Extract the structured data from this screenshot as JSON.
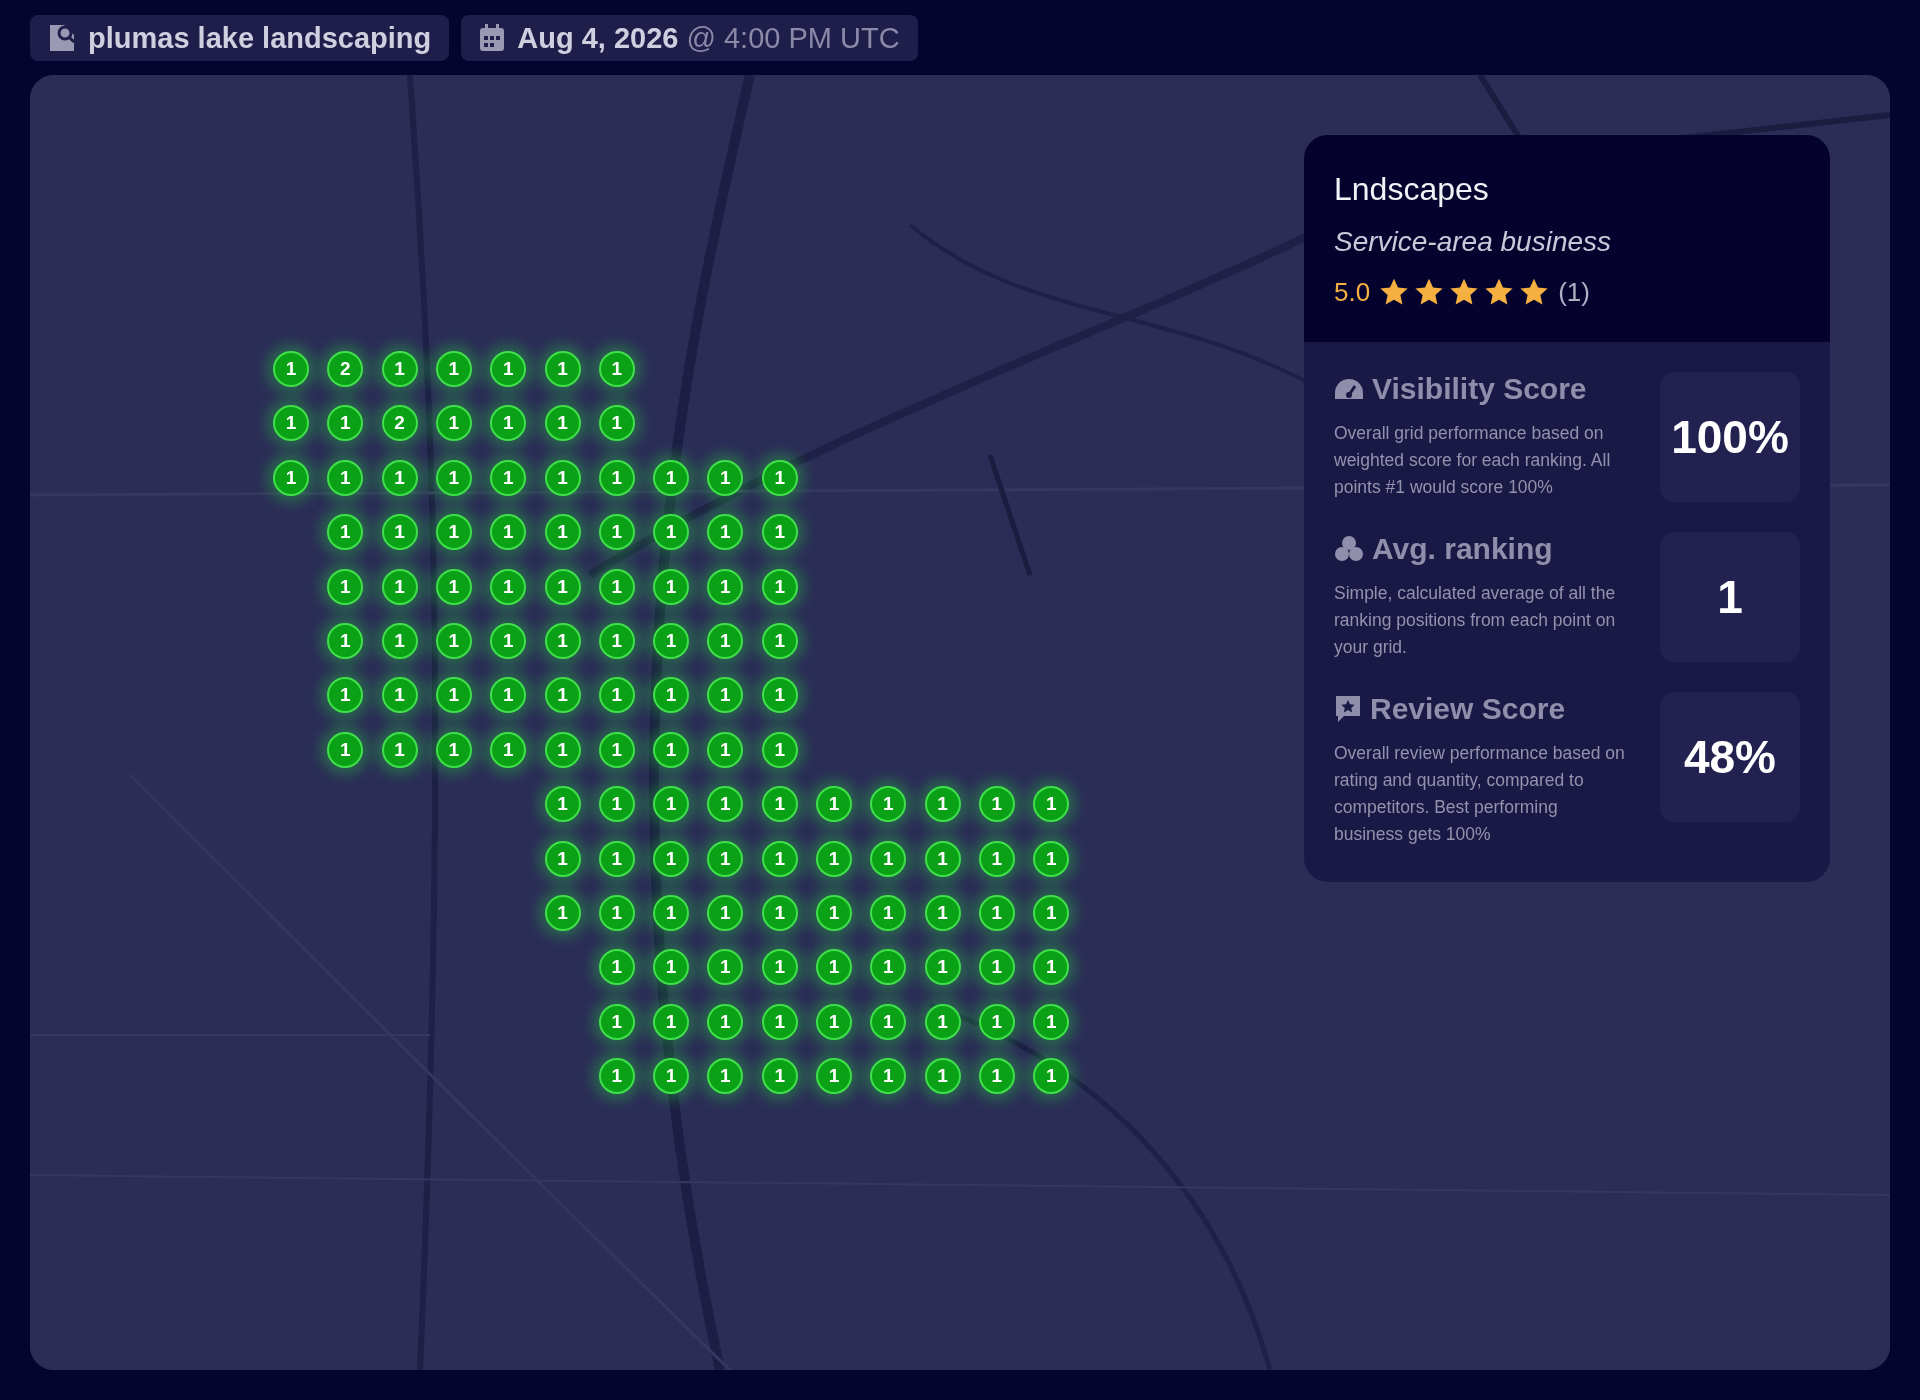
{
  "header": {
    "keyword": "plumas lake landscaping",
    "date": "Aug 4, 2026",
    "time": "@ 4:00 PM UTC"
  },
  "grid": {
    "rows": [
      [
        "1",
        "2",
        "1",
        "1",
        "1",
        "1",
        "1",
        null,
        null,
        null,
        null,
        null,
        null,
        null,
        null
      ],
      [
        "1",
        "1",
        "2",
        "1",
        "1",
        "1",
        "1",
        null,
        null,
        null,
        null,
        null,
        null,
        null,
        null
      ],
      [
        "1",
        "1",
        "1",
        "1",
        "1",
        "1",
        "1",
        "1",
        "1",
        "1",
        null,
        null,
        null,
        null,
        null
      ],
      [
        null,
        "1",
        "1",
        "1",
        "1",
        "1",
        "1",
        "1",
        "1",
        "1",
        null,
        null,
        null,
        null,
        null
      ],
      [
        null,
        "1",
        "1",
        "1",
        "1",
        "1",
        "1",
        "1",
        "1",
        "1",
        null,
        null,
        null,
        null,
        null
      ],
      [
        null,
        "1",
        "1",
        "1",
        "1",
        "1",
        "1",
        "1",
        "1",
        "1",
        null,
        null,
        null,
        null,
        null
      ],
      [
        null,
        "1",
        "1",
        "1",
        "1",
        "1",
        "1",
        "1",
        "1",
        "1",
        null,
        null,
        null,
        null,
        null
      ],
      [
        null,
        "1",
        "1",
        "1",
        "1",
        "1",
        "1",
        "1",
        "1",
        "1",
        null,
        null,
        null,
        null,
        null
      ],
      [
        null,
        null,
        null,
        null,
        null,
        "1",
        "1",
        "1",
        "1",
        "1",
        "1",
        "1",
        "1",
        "1",
        "1"
      ],
      [
        null,
        null,
        null,
        null,
        null,
        "1",
        "1",
        "1",
        "1",
        "1",
        "1",
        "1",
        "1",
        "1",
        "1"
      ],
      [
        null,
        null,
        null,
        null,
        null,
        "1",
        "1",
        "1",
        "1",
        "1",
        "1",
        "1",
        "1",
        "1",
        "1"
      ],
      [
        null,
        null,
        null,
        null,
        null,
        null,
        "1",
        "1",
        "1",
        "1",
        "1",
        "1",
        "1",
        "1",
        "1"
      ],
      [
        null,
        null,
        null,
        null,
        null,
        null,
        "1",
        "1",
        "1",
        "1",
        "1",
        "1",
        "1",
        "1",
        "1"
      ],
      [
        null,
        null,
        null,
        null,
        null,
        null,
        "1",
        "1",
        "1",
        "1",
        "1",
        "1",
        "1",
        "1",
        "1"
      ]
    ]
  },
  "business": {
    "name": "Lndscapes",
    "type": "Service-area business",
    "rating": "5.0",
    "stars": 5,
    "review_count": "(1)"
  },
  "metrics": [
    {
      "kind": "visibility",
      "title": "Visibility Score",
      "description": "Overall grid performance based on weighted score for each ranking. All points #1 would score 100%",
      "value": "100%"
    },
    {
      "kind": "ranking",
      "title": "Avg. ranking",
      "description": "Simple, calculated average of all the ranking positions from each point on your grid.",
      "value": "1"
    },
    {
      "kind": "review",
      "title": "Review Score",
      "description": "Overall review performance based on rating and quantity, compared to competitors. Best performing business gets 100%",
      "value": "48%"
    }
  ]
}
